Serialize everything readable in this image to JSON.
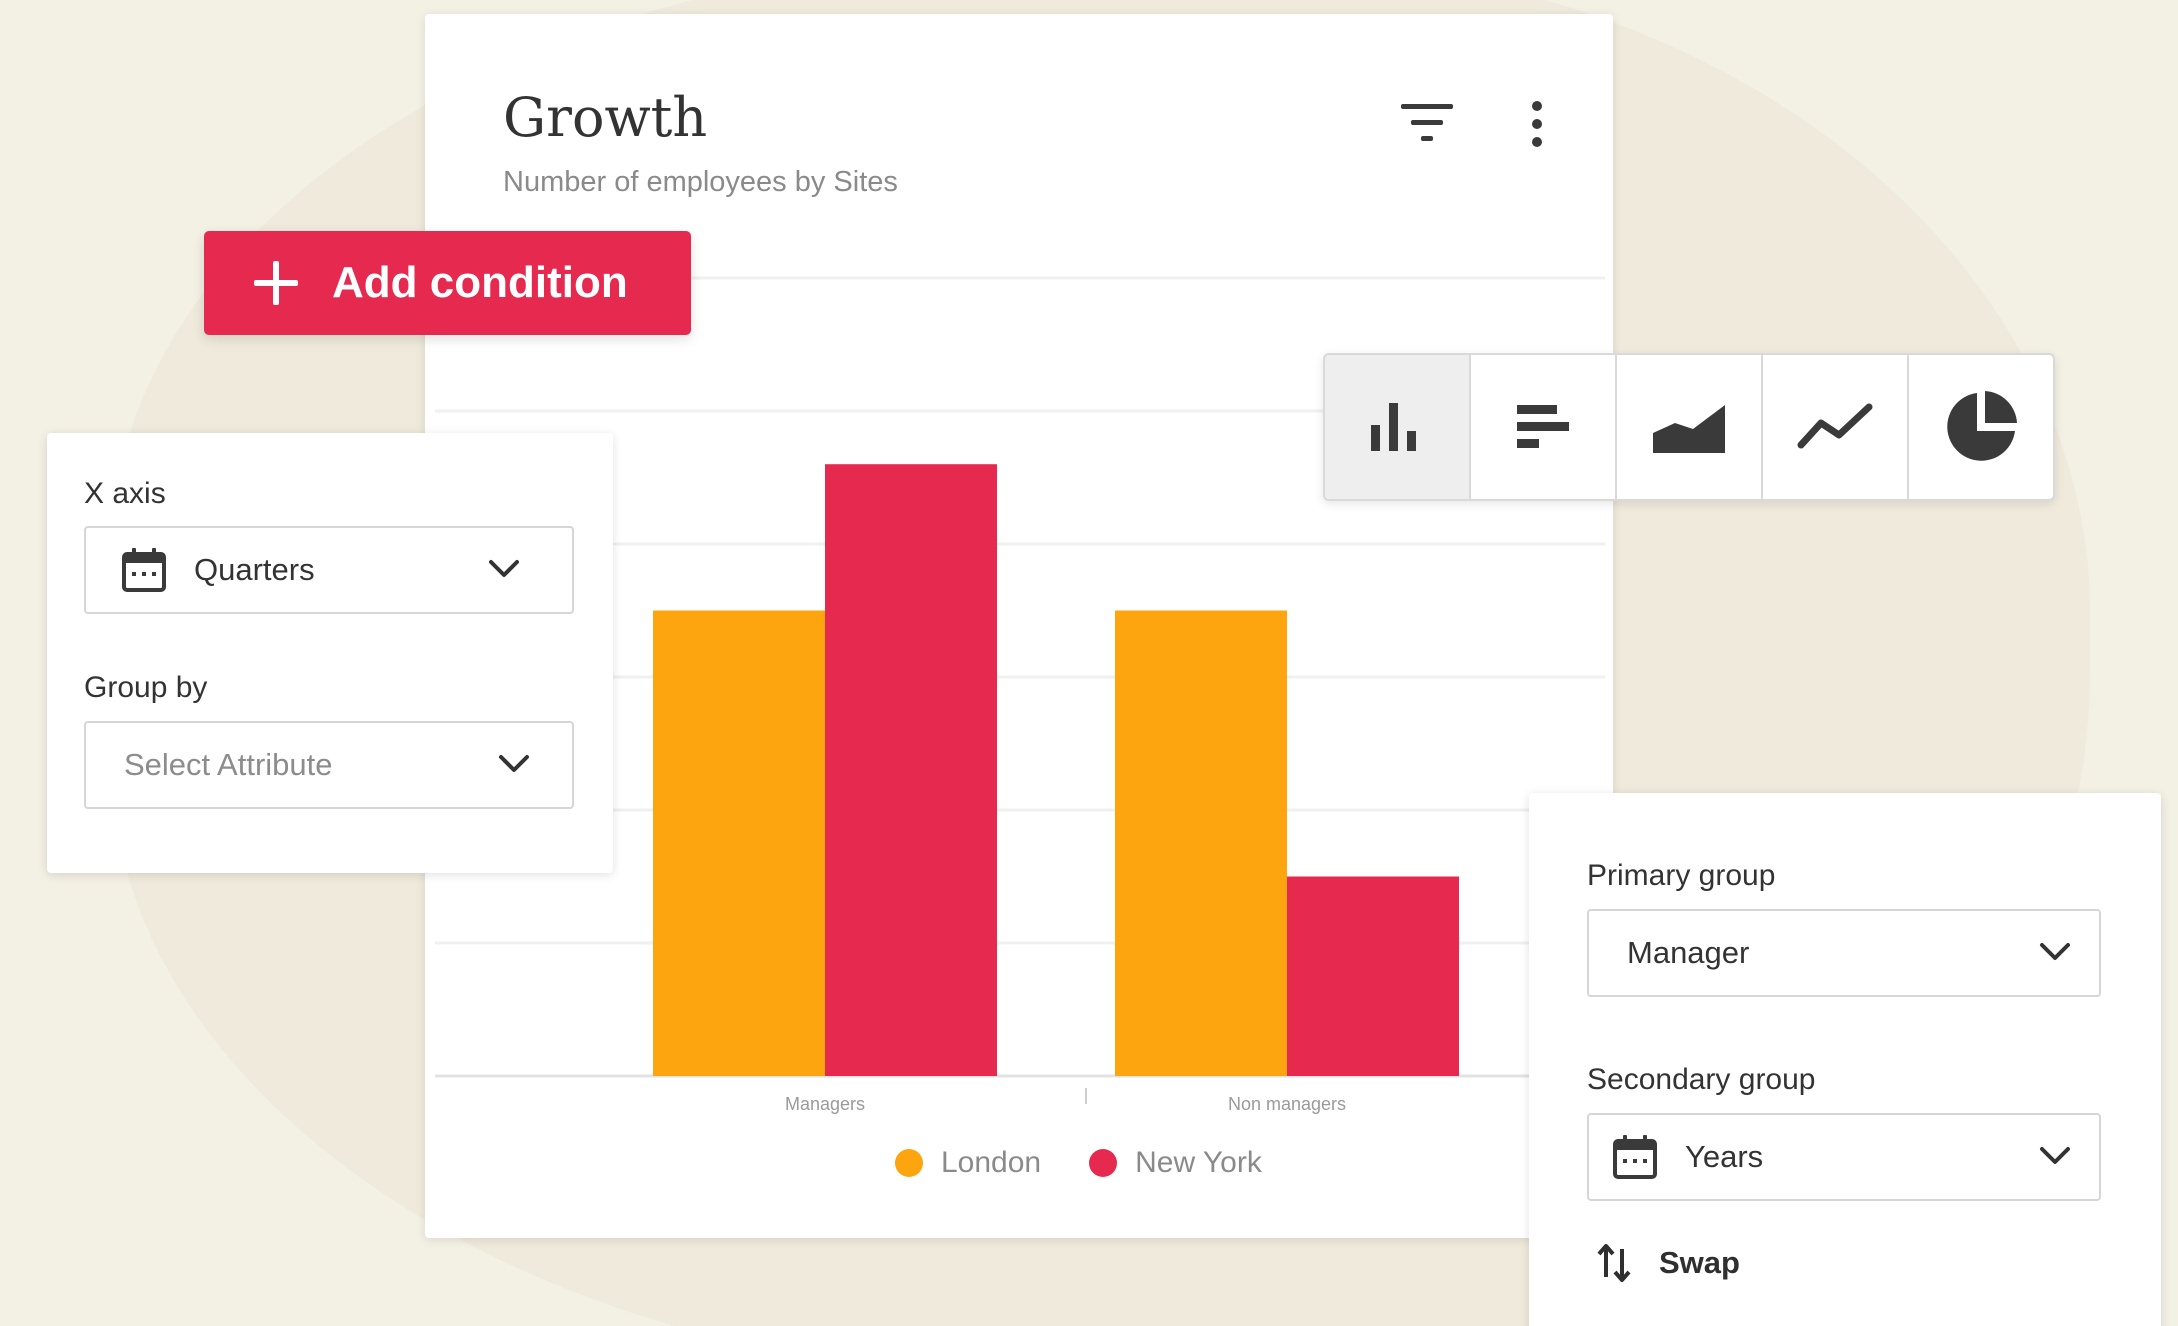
{
  "card": {
    "title": "Growth",
    "subtitle": "Number of employees by Sites"
  },
  "add_condition": {
    "label": "Add condition"
  },
  "x_axis_panel": {
    "x_axis_label": "X axis",
    "x_axis_value": "Quarters",
    "group_by_label": "Group by",
    "group_by_placeholder": "Select Attribute"
  },
  "group_panel": {
    "primary_label": "Primary group",
    "primary_value": "Manager",
    "secondary_label": "Secondary group",
    "secondary_value": "Years",
    "swap_label": "Swap"
  },
  "chart_types": [
    {
      "icon": "bar-chart-icon",
      "active": true
    },
    {
      "icon": "horizontal-bar-chart-icon",
      "active": false
    },
    {
      "icon": "area-chart-icon",
      "active": false
    },
    {
      "icon": "line-chart-icon",
      "active": false
    },
    {
      "icon": "pie-chart-icon",
      "active": false
    }
  ],
  "colors": {
    "accent": "#e62a4f",
    "london": "#fda50f",
    "new_york": "#e62a4f"
  },
  "chart_data": {
    "type": "bar",
    "title": "Growth",
    "subtitle": "Number of employees by Sites",
    "categories": [
      "Managers",
      "Non managers"
    ],
    "series": [
      {
        "name": "London",
        "values": [
          7,
          7
        ],
        "color": "#fda50f"
      },
      {
        "name": "New York",
        "values": [
          9.2,
          3
        ]
      }
    ],
    "ylim": [
      0,
      12
    ],
    "grid": true,
    "legend_position": "bottom"
  }
}
